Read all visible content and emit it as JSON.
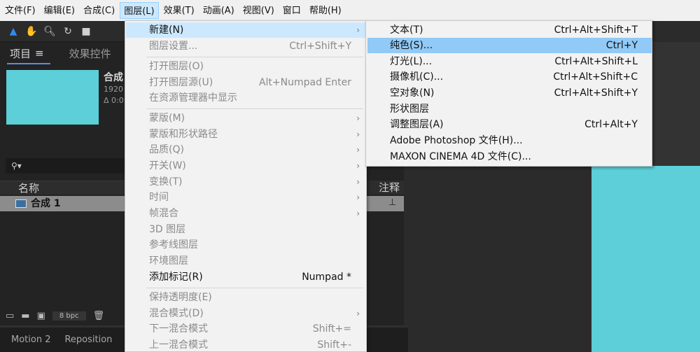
{
  "menubar": [
    "文件(F)",
    "编辑(E)",
    "合成(C)",
    "图层(L)",
    "效果(T)",
    "动画(A)",
    "视图(V)",
    "窗口",
    "帮助(H)"
  ],
  "project_panel": {
    "tab_project": "项目",
    "tab_effects": "效果控件",
    "comp_name": "合成",
    "comp_size": "1920",
    "comp_duration": "Δ 0:0",
    "column_name": "名称",
    "row_comp": "合成 1",
    "bpc": "8 bpc",
    "column_notes": "注释"
  },
  "bottom_tabs": [
    "Motion 2",
    "Reposition"
  ],
  "layer_menu": {
    "items": [
      {
        "label": "新建(N)",
        "shortcut": "",
        "submenu": true,
        "disabled": false,
        "highlight": true
      },
      {
        "label": "图层设置...",
        "shortcut": "Ctrl+Shift+Y",
        "submenu": false,
        "disabled": true
      },
      {
        "label": "打开图层(O)",
        "shortcut": "",
        "submenu": false,
        "disabled": true
      },
      {
        "label": "打开图层源(U)",
        "shortcut": "Alt+Numpad Enter",
        "submenu": false,
        "disabled": true
      },
      {
        "label": "在资源管理器中显示",
        "shortcut": "",
        "submenu": false,
        "disabled": true
      },
      {
        "label": "蒙版(M)",
        "shortcut": "",
        "submenu": true,
        "disabled": true
      },
      {
        "label": "蒙版和形状路径",
        "shortcut": "",
        "submenu": true,
        "disabled": true
      },
      {
        "label": "品质(Q)",
        "shortcut": "",
        "submenu": true,
        "disabled": true
      },
      {
        "label": "开关(W)",
        "shortcut": "",
        "submenu": true,
        "disabled": true
      },
      {
        "label": "变换(T)",
        "shortcut": "",
        "submenu": true,
        "disabled": true
      },
      {
        "label": "时间",
        "shortcut": "",
        "submenu": true,
        "disabled": true
      },
      {
        "label": "帧混合",
        "shortcut": "",
        "submenu": true,
        "disabled": true
      },
      {
        "label": "3D 图层",
        "shortcut": "",
        "submenu": false,
        "disabled": true
      },
      {
        "label": "参考线图层",
        "shortcut": "",
        "submenu": false,
        "disabled": true
      },
      {
        "label": "环境图层",
        "shortcut": "",
        "submenu": false,
        "disabled": true
      },
      {
        "label": "添加标记(R)",
        "shortcut": "Numpad *",
        "submenu": false,
        "disabled": false
      },
      {
        "label": "保持透明度(E)",
        "shortcut": "",
        "submenu": false,
        "disabled": true
      },
      {
        "label": "混合模式(D)",
        "shortcut": "",
        "submenu": true,
        "disabled": true
      },
      {
        "label": "下一混合模式",
        "shortcut": "Shift+=",
        "submenu": false,
        "disabled": true
      },
      {
        "label": "上一混合模式",
        "shortcut": "Shift+-",
        "submenu": false,
        "disabled": true
      }
    ]
  },
  "new_submenu": {
    "items": [
      {
        "label": "文本(T)",
        "shortcut": "Ctrl+Alt+Shift+T"
      },
      {
        "label": "纯色(S)...",
        "shortcut": "Ctrl+Y",
        "highlight": true
      },
      {
        "label": "灯光(L)...",
        "shortcut": "Ctrl+Alt+Shift+L"
      },
      {
        "label": "摄像机(C)...",
        "shortcut": "Ctrl+Alt+Shift+C"
      },
      {
        "label": "空对象(N)",
        "shortcut": "Ctrl+Alt+Shift+Y"
      },
      {
        "label": "形状图层",
        "shortcut": ""
      },
      {
        "label": "调整图层(A)",
        "shortcut": "Ctrl+Alt+Y"
      },
      {
        "label": "Adobe Photoshop 文件(H)...",
        "shortcut": ""
      },
      {
        "label": "MAXON CINEMA 4D 文件(C)...",
        "shortcut": ""
      }
    ]
  },
  "colors": {
    "accent_highlight": "#cce8ff",
    "submenu_highlight": "#91c9f7",
    "comp_color": "#5ccfd8"
  }
}
